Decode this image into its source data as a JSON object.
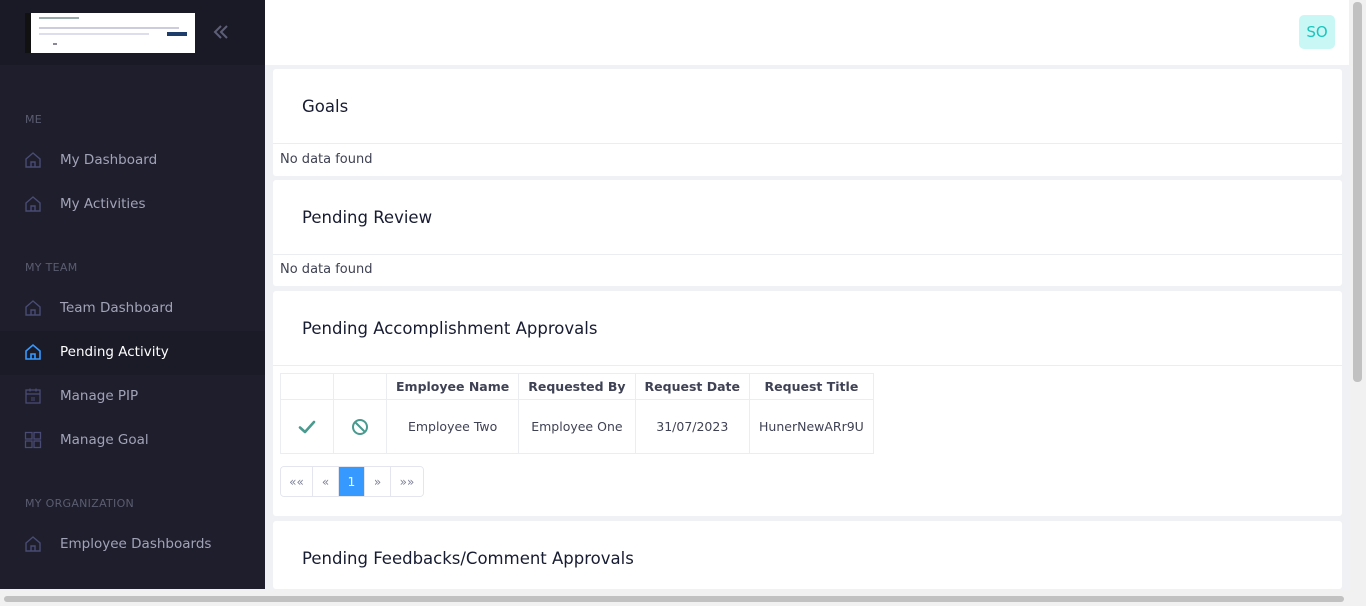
{
  "sidebar": {
    "sections": [
      "ME",
      "MY TEAM",
      "MY ORGANIZATION"
    ],
    "items": [
      {
        "label": "My Dashboard",
        "icon": "home-icon"
      },
      {
        "label": "My Activities",
        "icon": "home-icon"
      },
      {
        "label": "Team Dashboard",
        "icon": "home-icon"
      },
      {
        "label": "Pending Activity",
        "icon": "home-icon",
        "active": true
      },
      {
        "label": "Manage PIP",
        "icon": "calendar-icon"
      },
      {
        "label": "Manage Goal",
        "icon": "grid-icon"
      },
      {
        "label": "Employee Dashboards",
        "icon": "home-icon"
      }
    ]
  },
  "header": {
    "avatar_initials": "SO"
  },
  "cards": {
    "goals": {
      "title": "Goals",
      "empty": "No data found"
    },
    "pending_review": {
      "title": "Pending Review",
      "empty": "No data found"
    },
    "accomplishment": {
      "title": "Pending Accomplishment Approvals",
      "columns": [
        "",
        "",
        "Employee Name",
        "Requested By",
        "Request Date",
        "Request Title"
      ],
      "rows": [
        {
          "employee_name": "Employee Two",
          "requested_by": "Employee One",
          "request_date": "31/07/2023",
          "request_title": "HunerNewARr9U"
        }
      ],
      "pager": [
        "««",
        "«",
        "1",
        "»",
        "»»"
      ]
    },
    "feedback": {
      "title": "Pending Feedbacks/Comment Approvals"
    }
  },
  "colors": {
    "accent": "#3699ff",
    "sidebar_bg": "#1e1e2d",
    "approve": "#1bc5bd",
    "avatar_bg": "#c9f7f5"
  }
}
